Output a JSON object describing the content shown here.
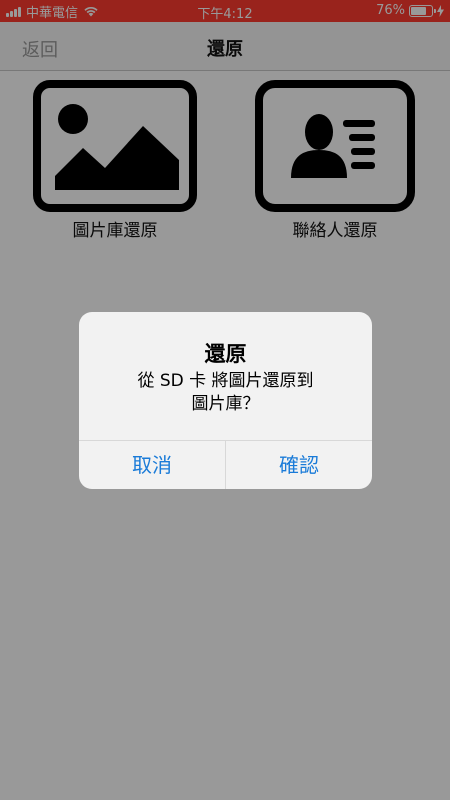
{
  "status_bar": {
    "carrier": "中華電信",
    "time": "下午4:12",
    "battery_percent": "76%",
    "battery_level": 0.76,
    "background_color": "#ff3b30"
  },
  "nav": {
    "back_label": "返回",
    "title": "還原"
  },
  "tiles": [
    {
      "label": "圖片庫還原",
      "icon": "photo-library-icon"
    },
    {
      "label": "聯絡人還原",
      "icon": "contact-card-icon"
    }
  ],
  "alert": {
    "title": "還原",
    "message_line1": "從 SD 卡 將圖片還原到",
    "message_line2": "圖片庫？",
    "cancel_label": "取消",
    "confirm_label": "確認",
    "button_color": "#1a7bd8"
  }
}
